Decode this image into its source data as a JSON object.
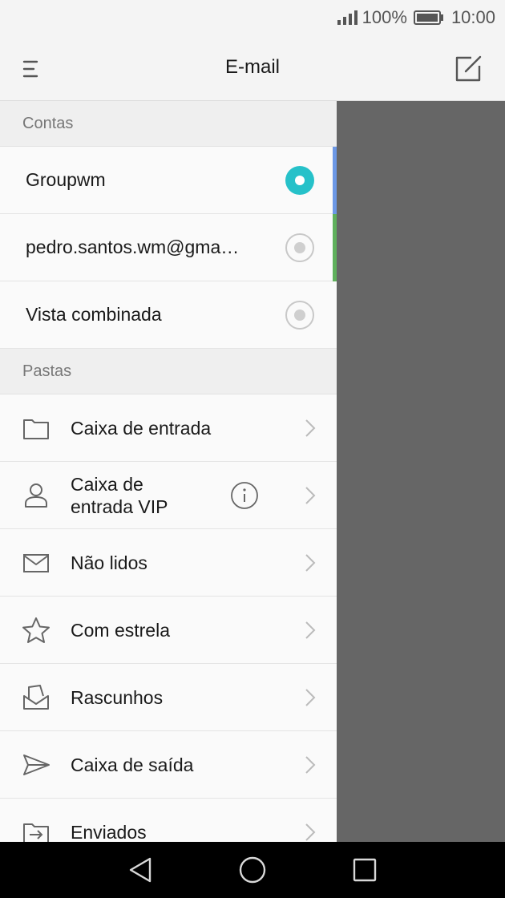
{
  "status_bar": {
    "battery": "100%",
    "time": "10:00"
  },
  "app_bar": {
    "title": "E-mail",
    "menu_icon": "hamburger-menu-icon",
    "compose_icon": "compose-icon"
  },
  "drawer": {
    "accounts_header": "Contas",
    "accounts": [
      {
        "label": "Groupwm",
        "selected": true,
        "stripe_color": "#6c98e6"
      },
      {
        "label": "pedro.santos.wm@gma…",
        "selected": false,
        "stripe_color": "#5fb05c"
      },
      {
        "label": "Vista combinada",
        "selected": false,
        "stripe_color": ""
      }
    ],
    "folders_header": "Pastas",
    "folders": [
      {
        "line1": "Caixa de entrada",
        "line2": "",
        "icon": "folder-icon"
      },
      {
        "line1": "Caixa de",
        "line2": "entrada VIP",
        "icon": "person-icon",
        "has_info": true
      },
      {
        "line1": "Não lidos",
        "line2": "",
        "icon": "envelope-icon"
      },
      {
        "line1": "Com estrela",
        "line2": "",
        "icon": "star-icon"
      },
      {
        "line1": "Rascunhos",
        "line2": "",
        "icon": "drafts-icon"
      },
      {
        "line1": "Caixa de saída",
        "line2": "",
        "icon": "send-icon"
      },
      {
        "line1": "Enviados",
        "line2": "",
        "icon": "sent-folder-icon"
      }
    ]
  },
  "colors": {
    "accent": "#26c1c9",
    "scrim": "#666666",
    "background": "#f4f4f4"
  },
  "nav_bar": {
    "back_icon": "back-triangle-icon",
    "home_icon": "home-circle-icon",
    "recents_icon": "recents-square-icon"
  }
}
